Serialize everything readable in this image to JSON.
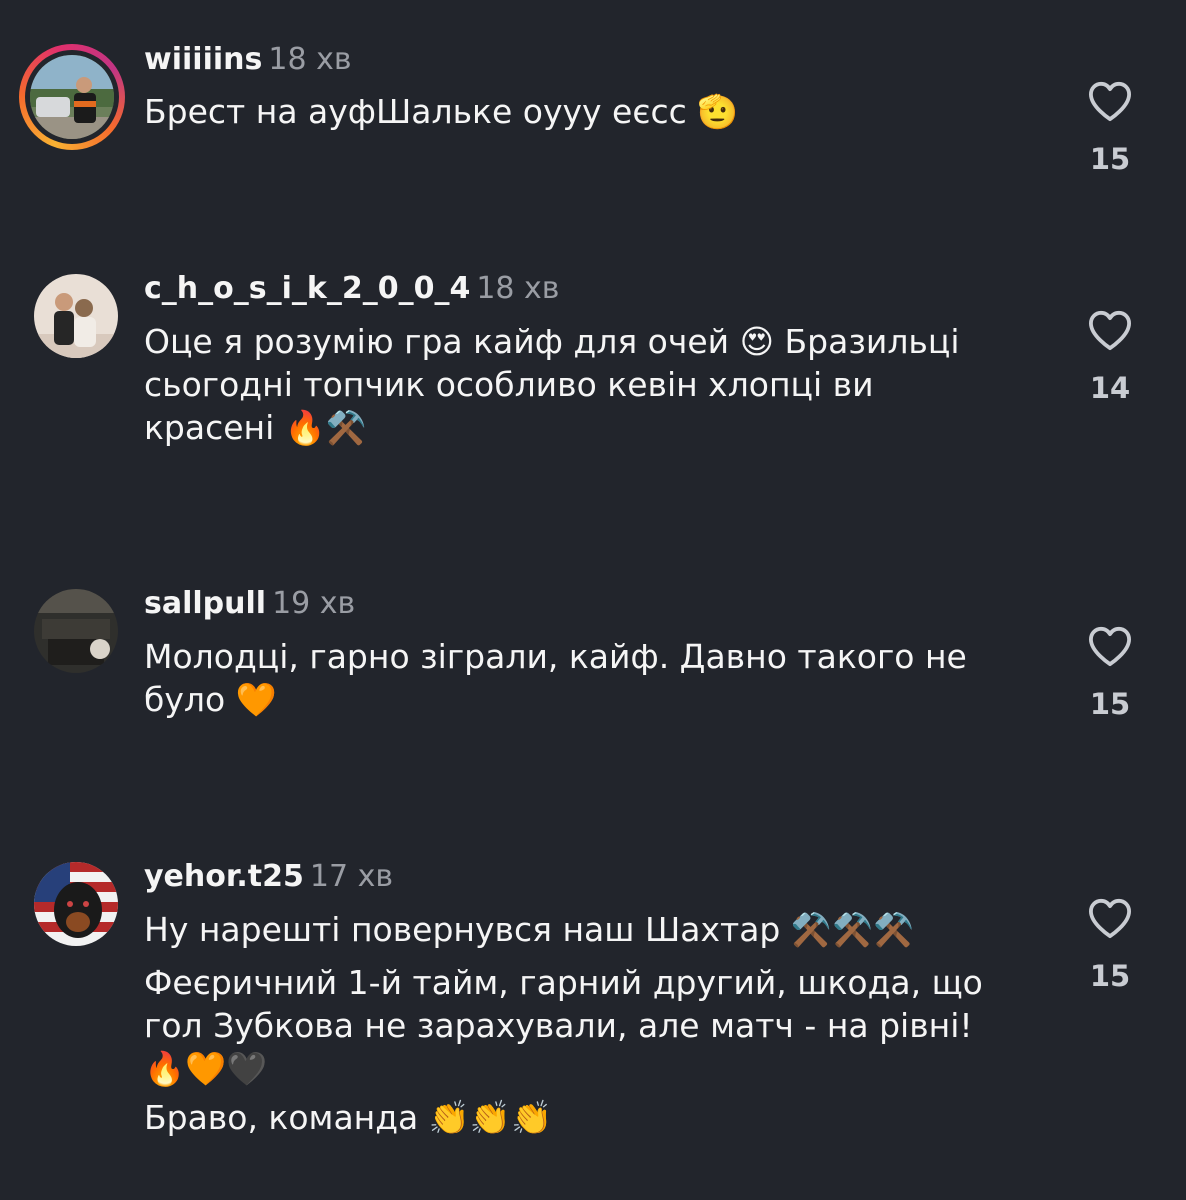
{
  "comments": [
    {
      "username": "wiiiiins",
      "time": "18 хв",
      "lines": [
        "Брест на ауфШальке оууу еєсс"
      ],
      "emoji_after": "🫡",
      "likes": "15",
      "avatar_icon": "avatar-photo-icon",
      "has_story_ring": true
    },
    {
      "username": "c_h_o_s_i_k_2_0_0_4",
      "time": "18 хв",
      "lines": [
        "Оце я розумію гра кайф для очей",
        "сьогодні топчик особливо кевін хлопці ви",
        "красені"
      ],
      "line1_emoji": "😍",
      "line1_suffix": "Бразильці",
      "line3_emoji": "🔥⚒️",
      "likes": "14",
      "avatar_icon": "avatar-photo-icon",
      "has_story_ring": false
    },
    {
      "username": "sallpull",
      "time": "19 хв",
      "lines": [
        "Молодці, гарно зіграли, кайф. Давно такого не",
        "було"
      ],
      "line2_emoji": "🧡",
      "likes": "15",
      "avatar_icon": "avatar-photo-icon",
      "has_story_ring": false
    },
    {
      "username": "yehor.t25",
      "time": "17 хв",
      "lines": [
        "Ну нарешті повернувся наш Шахтар",
        "Феєричний 1-й тайм, гарний другий, шкода, що",
        "гол Зубкова не зарахували, але матч - на рівні!",
        "",
        "Браво, команда"
      ],
      "line1_emoji": "⚒️⚒️⚒️",
      "line4_emoji": "🔥🧡🖤",
      "line5_emoji": "👏👏👏",
      "likes": "15",
      "avatar_icon": "avatar-photo-icon",
      "has_story_ring": false
    }
  ],
  "colors": {
    "background": "#22252c",
    "username": "#f5f5f5",
    "time": "#9a9da4",
    "count": "#c9ccd2"
  },
  "icons": {
    "like": "heart-outline-icon"
  }
}
